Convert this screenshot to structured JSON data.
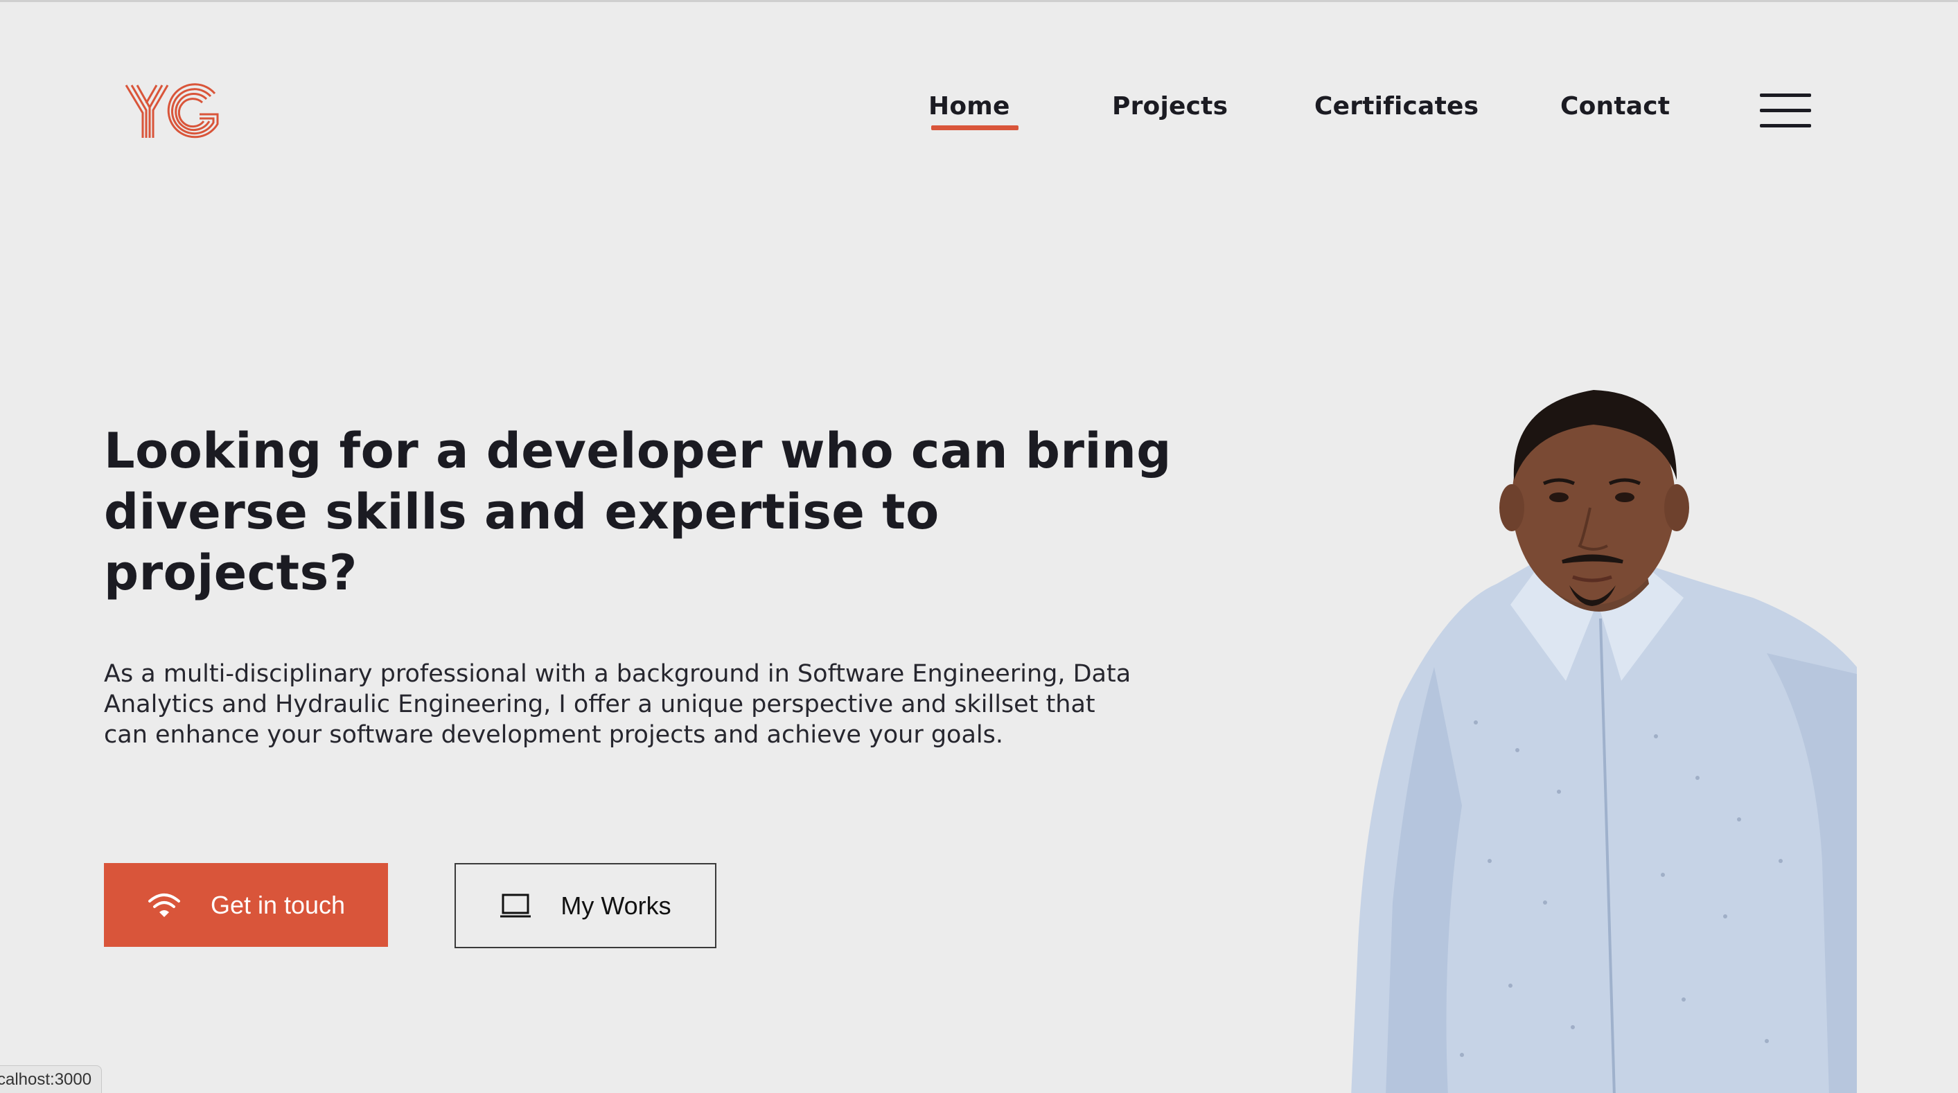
{
  "logo": {
    "text": "YG",
    "color": "#d9553a"
  },
  "nav": {
    "items": [
      {
        "label": "Home",
        "active": true
      },
      {
        "label": "Projects",
        "active": false
      },
      {
        "label": "Certificates",
        "active": false
      },
      {
        "label": "Contact",
        "active": false
      }
    ],
    "menu_icon": "hamburger-menu-icon"
  },
  "hero": {
    "title": "Looking for a developer who can bring diverse skills and expertise to projects?",
    "description": "As a multi-disciplinary professional with a background in Software Engineering, Data Analytics and Hydraulic Engineering, I offer a unique perspective and skillset that can enhance your software development projects and achieve your goals.",
    "primary_button": {
      "label": "Get in touch",
      "icon": "wifi-icon"
    },
    "secondary_button": {
      "label": "My Works",
      "icon": "laptop-icon"
    }
  },
  "status_bar": {
    "url": "calhost:3000"
  },
  "colors": {
    "accent": "#d9553a",
    "background": "#ececec",
    "text": "#1b1b22"
  }
}
